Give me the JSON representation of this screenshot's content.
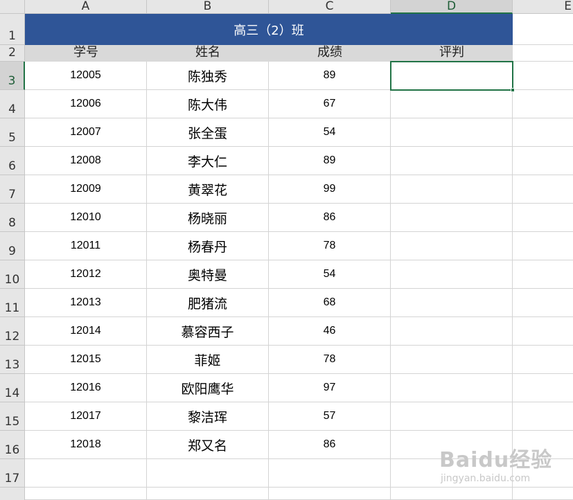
{
  "columns": [
    "A",
    "B",
    "C",
    "D",
    "E"
  ],
  "row_numbers": [
    "1",
    "2",
    "3",
    "4",
    "5",
    "6",
    "7",
    "8",
    "9",
    "10",
    "11",
    "12",
    "13",
    "14",
    "15",
    "16",
    "17"
  ],
  "title": "高三（2）班",
  "headers": {
    "id": "学号",
    "name": "姓名",
    "score": "成绩",
    "rating": "评判"
  },
  "rows": [
    {
      "id": "12005",
      "name": "陈独秀",
      "score": "89"
    },
    {
      "id": "12006",
      "name": "陈大伟",
      "score": "67"
    },
    {
      "id": "12007",
      "name": "张全蛋",
      "score": "54"
    },
    {
      "id": "12008",
      "name": "李大仁",
      "score": "89"
    },
    {
      "id": "12009",
      "name": "黄翠花",
      "score": "99"
    },
    {
      "id": "12010",
      "name": "杨晓丽",
      "score": "86"
    },
    {
      "id": "12011",
      "name": "杨春丹",
      "score": "78"
    },
    {
      "id": "12012",
      "name": "奥特曼",
      "score": "54"
    },
    {
      "id": "12013",
      "name": "肥猪流",
      "score": "68"
    },
    {
      "id": "12014",
      "name": "慕容西子",
      "score": "46"
    },
    {
      "id": "12015",
      "name": "菲姬",
      "score": "78"
    },
    {
      "id": "12016",
      "name": "欧阳鹰华",
      "score": "97"
    },
    {
      "id": "12017",
      "name": "黎洁珲",
      "score": "57"
    },
    {
      "id": "12018",
      "name": "郑又名",
      "score": "86"
    }
  ],
  "selected_cell": "D3",
  "watermark": {
    "brand": "Baidu经验",
    "url": "jingyan.baidu.com"
  }
}
